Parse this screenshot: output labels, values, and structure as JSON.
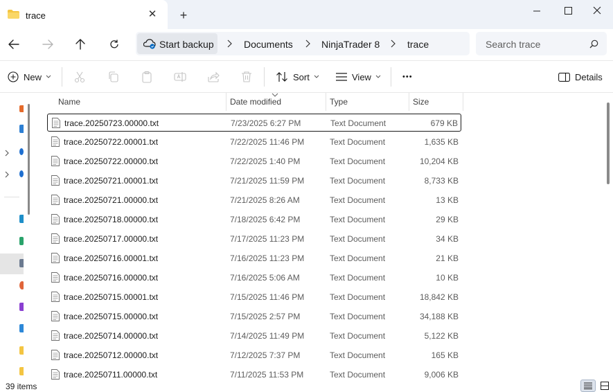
{
  "window": {
    "tab_title": "trace",
    "new_tab_symbol": "+",
    "close_tab_symbol": "✕"
  },
  "address": {
    "backup_label": "Start backup",
    "crumbs": [
      "Documents",
      "NinjaTrader 8",
      "trace"
    ],
    "search_placeholder": "Search trace"
  },
  "toolbar": {
    "new_label": "New",
    "sort_label": "Sort",
    "view_label": "View",
    "more_label": "•••",
    "details_label": "Details"
  },
  "columns": {
    "name": "Name",
    "date": "Date modified",
    "type": "Type",
    "size": "Size"
  },
  "files": [
    {
      "name": "trace.20250723.00000.txt",
      "date": "7/23/2025 6:27 PM",
      "type": "Text Document",
      "size": "679 KB"
    },
    {
      "name": "trace.20250722.00001.txt",
      "date": "7/22/2025 11:46 PM",
      "type": "Text Document",
      "size": "1,635 KB"
    },
    {
      "name": "trace.20250722.00000.txt",
      "date": "7/22/2025 1:40 PM",
      "type": "Text Document",
      "size": "10,204 KB"
    },
    {
      "name": "trace.20250721.00001.txt",
      "date": "7/21/2025 11:59 PM",
      "type": "Text Document",
      "size": "8,733 KB"
    },
    {
      "name": "trace.20250721.00000.txt",
      "date": "7/21/2025 8:26 AM",
      "type": "Text Document",
      "size": "13 KB"
    },
    {
      "name": "trace.20250718.00000.txt",
      "date": "7/18/2025 6:42 PM",
      "type": "Text Document",
      "size": "29 KB"
    },
    {
      "name": "trace.20250717.00000.txt",
      "date": "7/17/2025 11:23 PM",
      "type": "Text Document",
      "size": "34 KB"
    },
    {
      "name": "trace.20250716.00001.txt",
      "date": "7/16/2025 11:23 PM",
      "type": "Text Document",
      "size": "21 KB"
    },
    {
      "name": "trace.20250716.00000.txt",
      "date": "7/16/2025 5:06 AM",
      "type": "Text Document",
      "size": "10 KB"
    },
    {
      "name": "trace.20250715.00001.txt",
      "date": "7/15/2025 11:46 PM",
      "type": "Text Document",
      "size": "18,842 KB"
    },
    {
      "name": "trace.20250715.00000.txt",
      "date": "7/15/2025 2:57 PM",
      "type": "Text Document",
      "size": "34,188 KB"
    },
    {
      "name": "trace.20250714.00000.txt",
      "date": "7/14/2025 11:49 PM",
      "type": "Text Document",
      "size": "5,122 KB"
    },
    {
      "name": "trace.20250712.00000.txt",
      "date": "7/12/2025 7:37 PM",
      "type": "Text Document",
      "size": "165 KB"
    },
    {
      "name": "trace.20250711.00000.txt",
      "date": "7/11/2025 11:53 PM",
      "type": "Text Document",
      "size": "9,006 KB"
    }
  ],
  "status": {
    "item_count": "39 items"
  },
  "colors": {
    "accent": "#0067c0",
    "folder": "#f4c542",
    "selection_border": "#1a1a1a"
  },
  "icons": {
    "tab": "folder-icon",
    "close": "close-icon",
    "back": "back-arrow-icon",
    "forward": "forward-arrow-icon",
    "up": "up-arrow-icon",
    "refresh": "refresh-icon",
    "backup": "cloud-backup-icon",
    "search": "search-icon",
    "file": "text-file-icon"
  }
}
